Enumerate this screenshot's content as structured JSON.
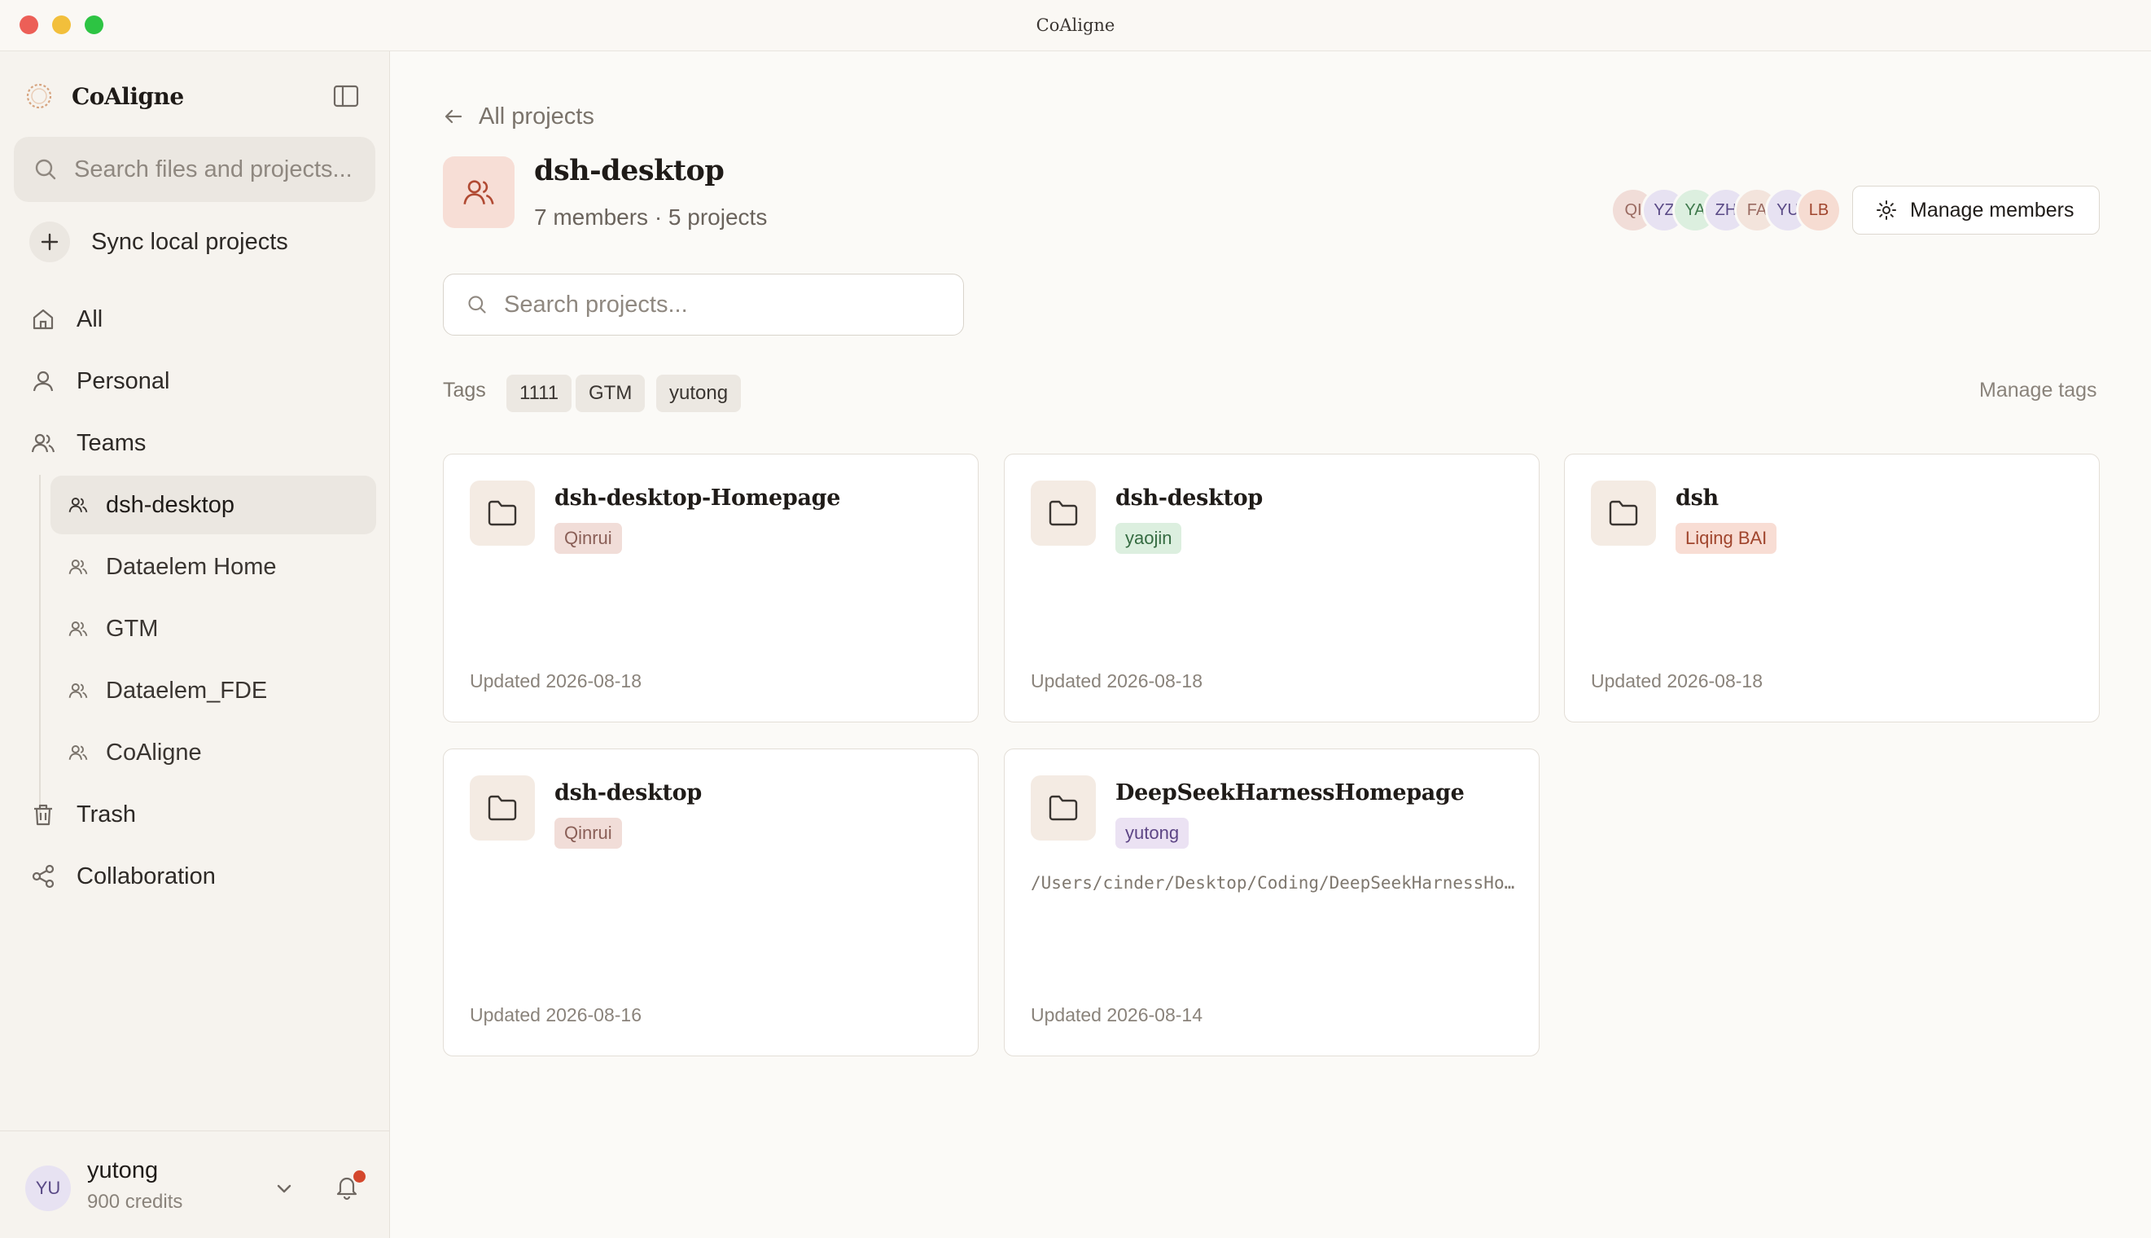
{
  "window": {
    "title": "CoAligne"
  },
  "sidebar": {
    "brand": "CoAligne",
    "search_placeholder": "Search files and projects...",
    "sync_label": "Sync local projects",
    "nav": {
      "all": "All",
      "personal": "Personal",
      "teams": "Teams",
      "trash": "Trash",
      "collaboration": "Collaboration"
    },
    "teams": [
      "dsh-desktop",
      "Dataelem Home",
      "GTM",
      "Dataelem_FDE",
      "CoAligne"
    ],
    "active_team": "dsh-desktop",
    "user": {
      "initials": "YU",
      "name": "yutong",
      "credits": "900 credits"
    }
  },
  "main": {
    "back_label": "All projects",
    "team_name": "dsh-desktop",
    "team_meta": "7 members · 5 projects",
    "members": [
      {
        "initials": "QI",
        "bg": "#f1ddd8",
        "fg": "#9a6b62"
      },
      {
        "initials": "YZ",
        "bg": "#e7e2f2",
        "fg": "#5a4a86"
      },
      {
        "initials": "YA",
        "bg": "#dcefdf",
        "fg": "#3f7a4c"
      },
      {
        "initials": "ZH",
        "bg": "#e7e2f2",
        "fg": "#5a4a86"
      },
      {
        "initials": "FA",
        "bg": "#f3e4dc",
        "fg": "#9a6b62"
      },
      {
        "initials": "YU",
        "bg": "#e7e2f2",
        "fg": "#5a4a86"
      },
      {
        "initials": "LB",
        "bg": "#f6dcd2",
        "fg": "#a0452d"
      }
    ],
    "manage_members_label": "Manage members",
    "search_placeholder": "Search projects...",
    "tags_label": "Tags",
    "tags": [
      "1111",
      "GTM",
      "yutong"
    ],
    "manage_tags_label": "Manage tags",
    "projects": [
      {
        "name": "dsh-desktop-Homepage",
        "owner": "Qinrui",
        "owner_bg": "#f1ddd8",
        "owner_fg": "#8a5f57",
        "path": "",
        "updated": "Updated 2026-08-18"
      },
      {
        "name": "dsh-desktop",
        "owner": "yaojin",
        "owner_bg": "#dcefdf",
        "owner_fg": "#356b41",
        "path": "",
        "updated": "Updated 2026-08-18"
      },
      {
        "name": "dsh",
        "owner": "Liqing BAI",
        "owner_bg": "#f8ddd4",
        "owner_fg": "#a0452d",
        "path": "",
        "updated": "Updated 2026-08-18"
      },
      {
        "name": "dsh-desktop",
        "owner": "Qinrui",
        "owner_bg": "#f1ddd8",
        "owner_fg": "#8a5f57",
        "path": "",
        "updated": "Updated 2026-08-16"
      },
      {
        "name": "DeepSeekHarnessHomepage",
        "owner": "yutong",
        "owner_bg": "#ebe2f3",
        "owner_fg": "#5d4585",
        "path": "/Users/cinder/Desktop/Coding/DeepSeekHarnessHomepage",
        "updated": "Updated 2026-08-14"
      }
    ]
  }
}
